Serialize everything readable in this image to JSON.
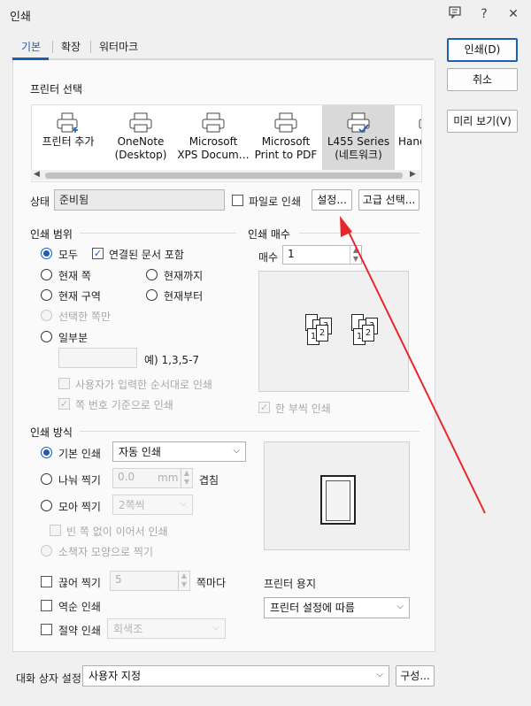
{
  "window": {
    "title": "인쇄",
    "help_icon": "?",
    "close_icon": "✕"
  },
  "tabs": [
    {
      "label": "기본"
    },
    {
      "label": "확장"
    },
    {
      "label": "워터마크"
    }
  ],
  "side_buttons": {
    "print": "인쇄(D)",
    "cancel": "취소",
    "preview": "미리 보기(V)"
  },
  "printer_select": {
    "title": "프린터 선택",
    "printers": [
      {
        "line1": "프린터 추가",
        "line2": ""
      },
      {
        "line1": "OneNote",
        "line2": "(Desktop)"
      },
      {
        "line1": "Microsoft",
        "line2": "XPS Docum…"
      },
      {
        "line1": "Microsoft",
        "line2": "Print to PDF"
      },
      {
        "line1": "L455 Series",
        "line2": "(네트워크)"
      },
      {
        "line1": "Hand",
        "line2": ""
      }
    ],
    "selected_index": 4
  },
  "status": {
    "label": "상태",
    "value": "준비됨",
    "print_to_file": "파일로 인쇄",
    "settings_button": "설정...",
    "advanced_button": "고급 선택..."
  },
  "print_range": {
    "title": "인쇄 범위",
    "all": "모두",
    "include_linked": "연결된 문서 포함",
    "current_page": "현재 쪽",
    "up_to_current": "현재까지",
    "current_section": "현재 구역",
    "from_current": "현재부터",
    "selected_only": "선택한 쪽만",
    "partial": "일부분",
    "partial_value": "",
    "example": "예) 1,3,5-7",
    "user_order": "사용자가 입력한 순서대로 인쇄",
    "page_number_basis": "쪽 번호 기준으로 인쇄"
  },
  "copies": {
    "title": "인쇄 매수",
    "label": "매수",
    "value": "1",
    "collate": "한 부씩 인쇄",
    "preview_pages": [
      "1",
      "2",
      "3"
    ]
  },
  "print_method": {
    "title": "인쇄 방식",
    "basic": "기본 인쇄",
    "basic_select": "자동 인쇄",
    "split": "나눠 찍기",
    "split_value": "0.0",
    "split_unit": "mm",
    "overlap": "겹침",
    "gather": "모아 찍기",
    "gather_select": "2쪽씩",
    "no_blank": "빈 쪽 없이 이어서 인쇄",
    "booklet": "소책자 모양으로 찍기",
    "cut": "끊어 찍기",
    "cut_value": "5",
    "per_pages": "쪽마다",
    "reverse": "역순 인쇄",
    "saving": "절약 인쇄",
    "saving_select": "회색조",
    "paper_label": "프린터 용지",
    "paper_select": "프린터 설정에 따름"
  },
  "bottom": {
    "label": "대화 상자 설정",
    "select": "사용자 지정",
    "config_button": "구성..."
  },
  "annotation": {
    "color": "#e8262a"
  }
}
